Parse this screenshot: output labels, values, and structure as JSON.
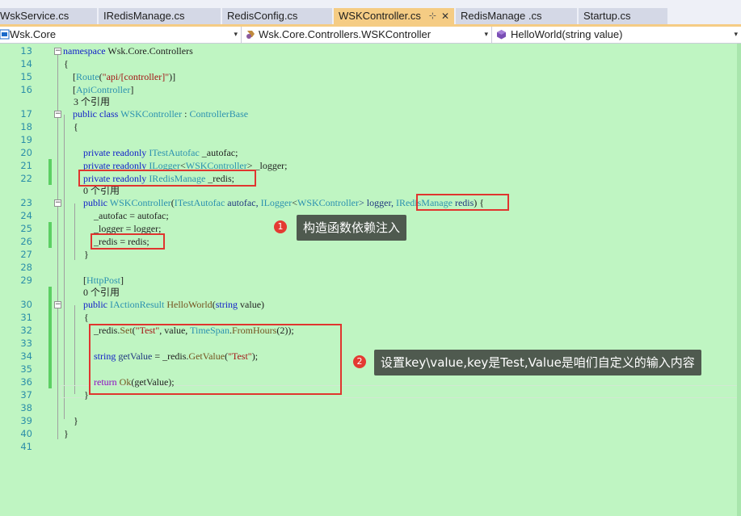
{
  "tabs": [
    {
      "label": "WskService.cs"
    },
    {
      "label": "IRedisManage.cs"
    },
    {
      "label": "RedisConfig.cs"
    },
    {
      "label": "WSKController.cs",
      "active": true,
      "pin": "⊹",
      "close": "✕"
    },
    {
      "label": "RedisManage .cs"
    },
    {
      "label": "Startup.cs"
    }
  ],
  "nav": {
    "project": "Wsk.Core",
    "class": "Wsk.Core.Controllers.WSKController",
    "member": "HelloWorld(string value)",
    "dropdown_arrow": "▾"
  },
  "line_numbers": [
    "13",
    "14",
    "15",
    "16",
    "17",
    "18",
    "19",
    "20",
    "21",
    "22",
    "23",
    "24",
    "25",
    "26",
    "27",
    "28",
    "29",
    "30",
    "31",
    "32",
    "33",
    "34",
    "35",
    "36",
    "37",
    "38",
    "39",
    "40",
    "41"
  ],
  "code": {
    "l13": {
      "kw": "namespace",
      "rest": " Wsk.Core.Controllers"
    },
    "l14": "{",
    "l15": {
      "open": "[",
      "type": "Route",
      "p1": "(",
      "str": "\"api/[controller]\"",
      "p2": ")]"
    },
    "l16": {
      "open": "[",
      "type": "ApiController",
      "close": "]"
    },
    "l16_refs": "3 个引用",
    "l17": {
      "kw": "public class",
      "sp": " ",
      "name": "WSKController",
      "colon": " : ",
      "base": "ControllerBase"
    },
    "l18": "{",
    "l20": {
      "kw": "private readonly",
      "sp": " ",
      "type": "ITestAutofac",
      "rest": " _autofac;"
    },
    "l21": {
      "kw": "private readonly",
      "sp": " ",
      "type": "ILogger",
      "lt": "<",
      "gen": "WSKController",
      "rest": "> _logger;"
    },
    "l22": {
      "kw": "private readonly",
      "sp": " ",
      "type": "IRedisManage",
      "rest": " _redis;"
    },
    "l22_refs": "0 个引用",
    "l23": {
      "kw": "public",
      "sp": " ",
      "name": "WSKController",
      "p": "(",
      "t1": "ITestAutofac",
      "a1": " autofac, ",
      "t2": "ILogger",
      "lt": "<",
      "t3": "WSKController",
      "a2": "> logger, ",
      "t4": "IRedisManage",
      "a3": " redis",
      "end": ") {"
    },
    "l24": "_autofac = autofac;",
    "l25": "_logger = logger;",
    "l26": "_redis = redis;",
    "l27": "}",
    "l29": {
      "open": "[",
      "type": "HttpPost",
      "close": "]"
    },
    "l29_refs": "0 个引用",
    "l30": {
      "kw": "public",
      "sp": " ",
      "type": "IActionResult",
      "sp2": " ",
      "method": "HelloWorld",
      "p": "(",
      "kw2": "string",
      "rest": " value)"
    },
    "l31": "{",
    "l32": {
      "a": "_redis.",
      "m": "Set",
      "p": "(",
      "s": "\"Test\"",
      "b": ", value, ",
      "t": "TimeSpan",
      "dot": ".",
      "m2": "FromHours",
      "end": "(2));"
    },
    "l34": {
      "kw": "string",
      "sp": " ",
      "var": "getValue",
      "a": " = _redis.",
      "m": "GetValue",
      "p": "(",
      "s": "\"Test\"",
      "end": ");"
    },
    "l36": {
      "kw": "return",
      "sp": " ",
      "m": "Ok",
      "end": "(getValue);"
    },
    "l37": "}",
    "l39": "}",
    "l40": "}"
  },
  "annotations": [
    {
      "number": "1",
      "text": "构造函数依赖注入"
    },
    {
      "number": "2",
      "text": "设置key\\value,key是Test,Value是咱们自定义的输入内容"
    }
  ],
  "colors": {
    "editor_bg": "#bff5c2",
    "active_tab": "#f5cc84",
    "highlight_box": "#e0352f",
    "callout_bg": "#4f5a4f",
    "keyword": "#1220c9",
    "type": "#2b91af",
    "string": "#a31515"
  },
  "icons": {
    "project": "csharp-project-icon",
    "class": "class-icon",
    "member": "method-icon",
    "fold": "collapse-minus-icon"
  }
}
